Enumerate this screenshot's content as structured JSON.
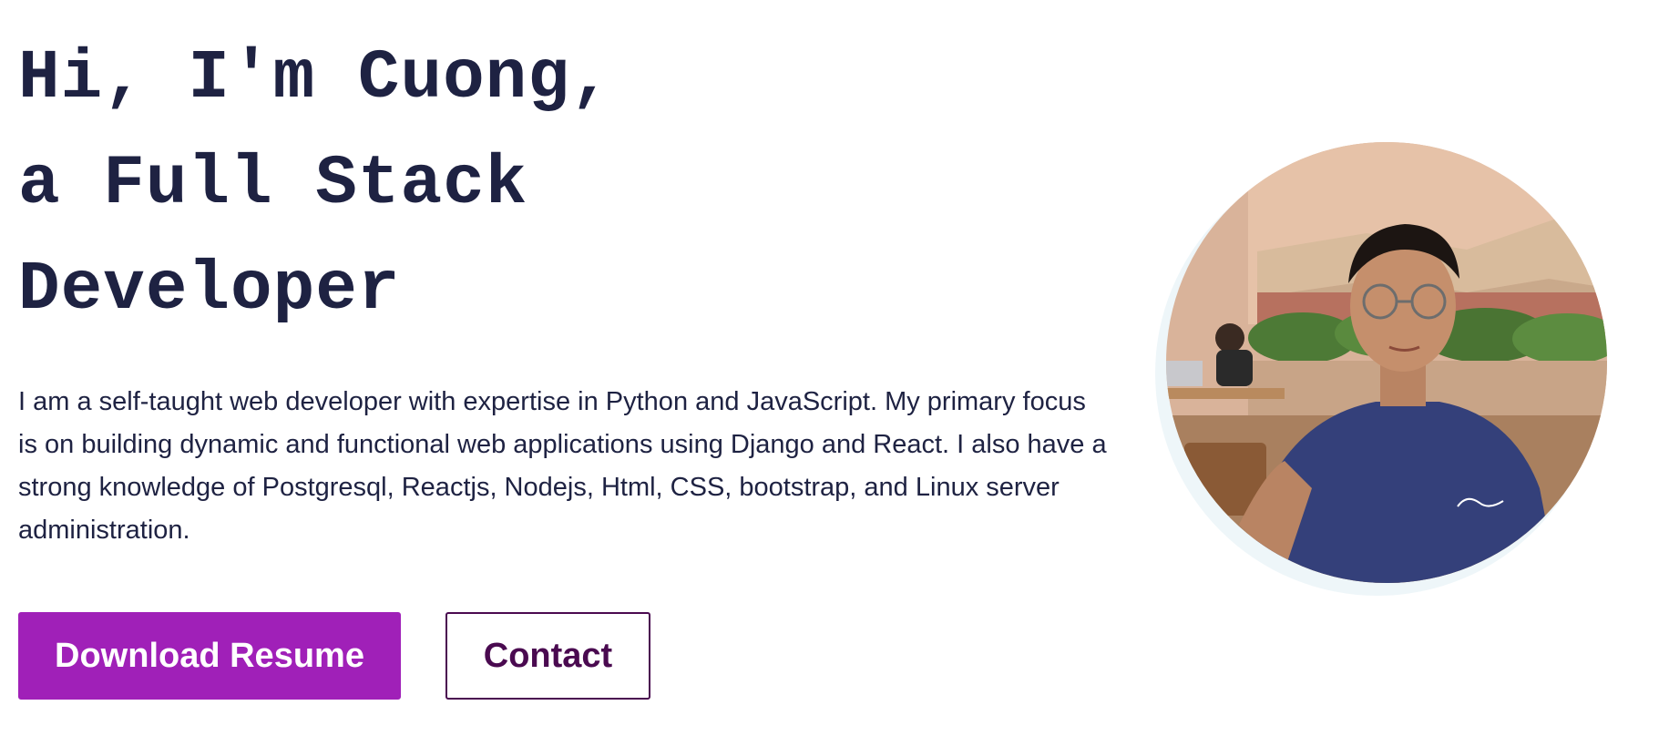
{
  "hero": {
    "heading_lines": [
      "Hi, I'm Cuong,",
      "a Full Stack",
      "Developer"
    ],
    "intro": "I am a self-taught web developer with expertise in Python and JavaScript. My primary focus is on building dynamic and functional web applications using Django and React. I also have a strong knowledge of Postgresql, Reactjs, Nodejs, Html, CSS, bootstrap, and Linux server administration.",
    "buttons": {
      "download_resume": "Download Resume",
      "contact": "Contact"
    }
  },
  "colors": {
    "text": "#1e2242",
    "primary": "#a020b8",
    "outline": "#4a0a50",
    "avatar_ring": "#eef6f9"
  }
}
